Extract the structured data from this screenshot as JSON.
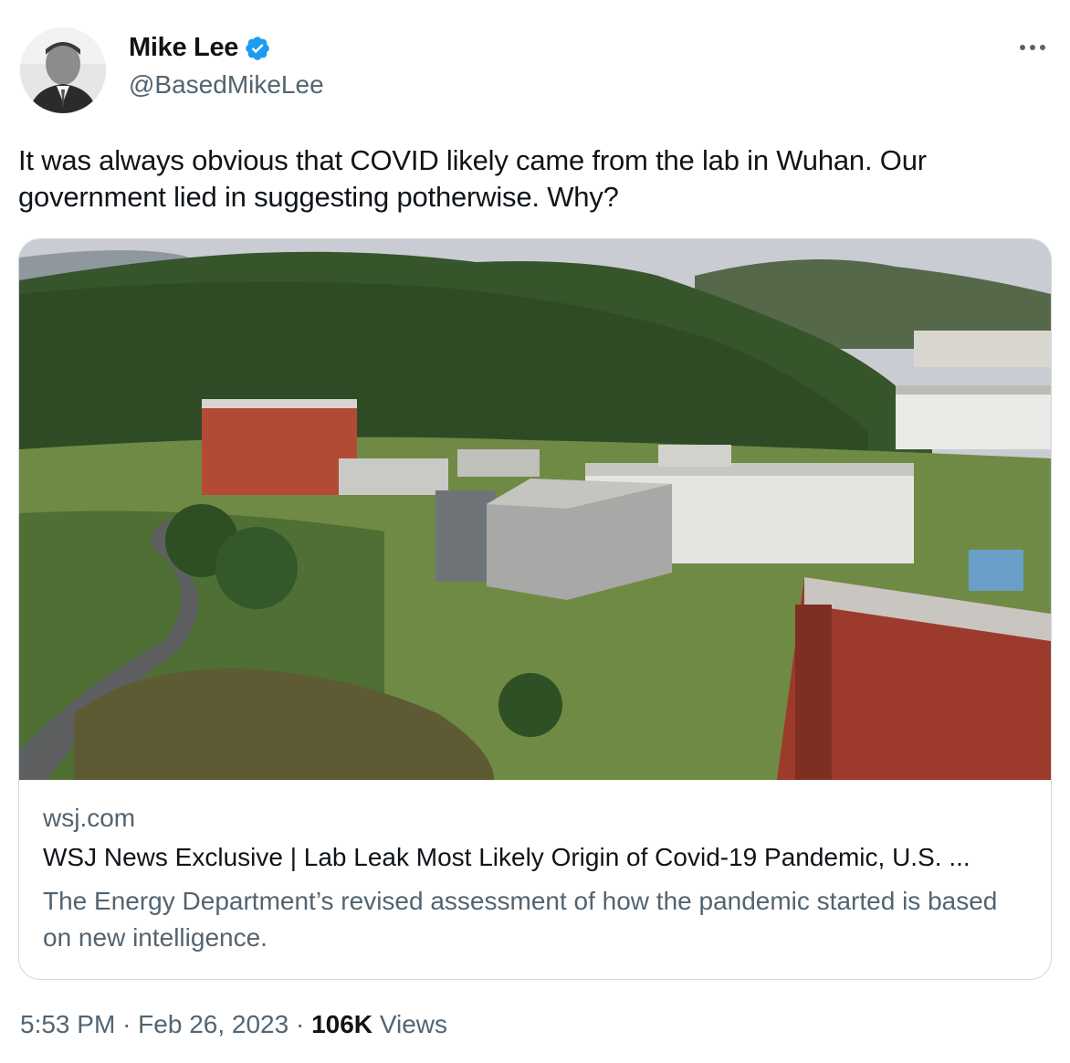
{
  "author": {
    "name": "Mike Lee",
    "handle": "@BasedMikeLee",
    "verified": true,
    "verified_color": "#1d9bf0"
  },
  "tweet": {
    "text": "It was always obvious that COVID likely came from the lab in Wuhan. Our government lied in suggesting potherwise. Why?"
  },
  "card": {
    "domain": "wsj.com",
    "title": "WSJ News Exclusive | Lab Leak Most Likely Origin of Covid-19 Pandemic, U.S. ...",
    "description": "The Energy Department’s revised assessment of how the pandemic started is based on new intelligence."
  },
  "meta": {
    "time": "5:53 PM",
    "separator": "·",
    "date": "Feb 26, 2023",
    "views_count": "106K",
    "views_label": "Views"
  },
  "icons": {
    "more": "more-horizontal-icon",
    "verified": "verified-badge-icon"
  }
}
